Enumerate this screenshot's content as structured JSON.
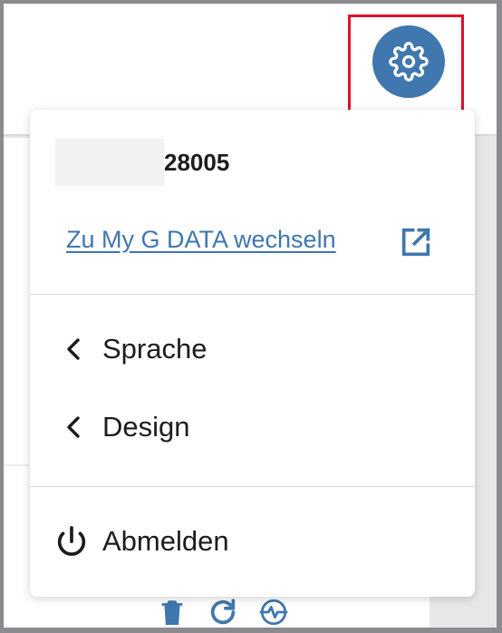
{
  "header": {
    "settings_icon": "gear-icon",
    "accent_color": "#3f77ae",
    "highlight_color": "#e0102a"
  },
  "menu": {
    "account_number": "28005",
    "switch_link": "Zu My G DATA wechseln",
    "external_icon": "external-link-icon",
    "items": [
      {
        "label": "Sprache",
        "icon": "chevron-left-icon"
      },
      {
        "label": "Design",
        "icon": "chevron-left-icon"
      }
    ],
    "logout": {
      "label": "Abmelden",
      "icon": "power-icon"
    }
  },
  "toolbar_icons": [
    "trash-icon",
    "refresh-icon",
    "activity-icon"
  ]
}
